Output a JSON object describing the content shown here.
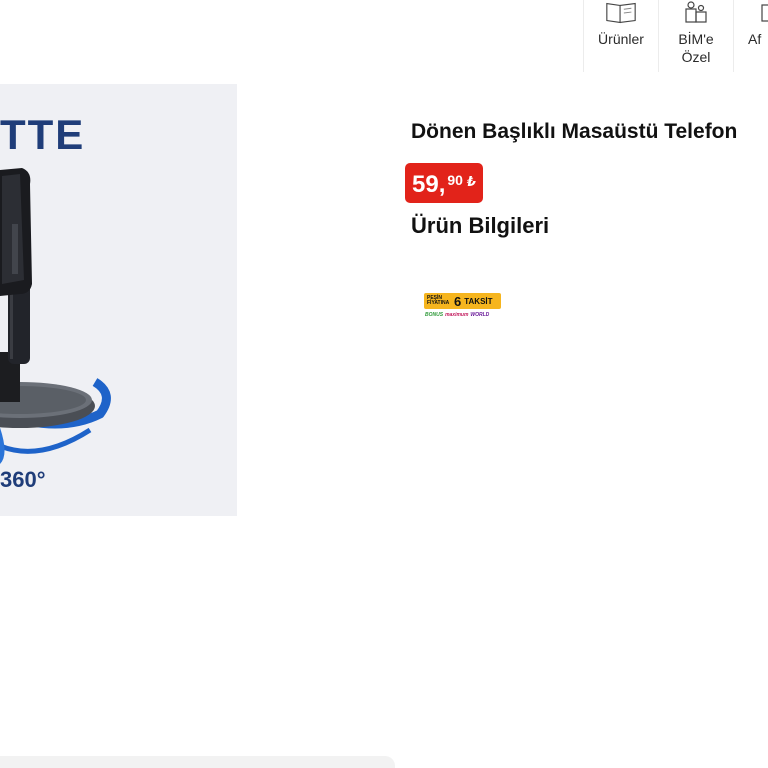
{
  "nav": {
    "items": [
      {
        "label": "Ürünler",
        "icon": "catalog-book-icon"
      },
      {
        "label": "BİM'e Özel",
        "icon": "special-products-icon"
      },
      {
        "label": "Af",
        "icon": "campaign-icon"
      }
    ]
  },
  "product": {
    "image": {
      "brand_text": "TTE",
      "rotation_text": "360°"
    },
    "title": "Dönen Başlıklı Masaüstü Telefon",
    "price": {
      "main": "59,",
      "cents": "90",
      "currency": "₺"
    },
    "section_title": "Ürün Bilgileri",
    "installment": {
      "pesin_text": "PEŞİN FİYATINA",
      "count": "6",
      "word": "TAKSİT",
      "stores": [
        "BONUS",
        "maximum",
        "WORLD"
      ]
    }
  },
  "colors": {
    "price_bg": "#e2231a",
    "brand_blue": "#1f3d79",
    "installment_bg": "#f6b51e",
    "image_bg": "#eff0f4"
  }
}
